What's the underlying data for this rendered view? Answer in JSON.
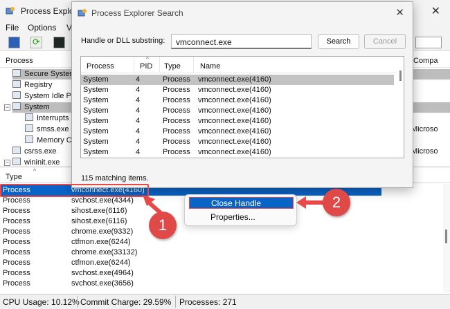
{
  "main_window": {
    "title": "Process Explo",
    "close_glyph": "✕",
    "menu": [
      "File",
      "Options",
      "V"
    ]
  },
  "toolbar": {
    "icons": [
      "save-icon",
      "refresh-icon",
      "cpu-graph-icon"
    ]
  },
  "process_tree": {
    "header_process": "Process",
    "header_company": "Compa",
    "rows": [
      {
        "name": "Secure Syster",
        "indent": 1,
        "selected": true
      },
      {
        "name": "Registry",
        "indent": 1,
        "selected": false
      },
      {
        "name": "System Idle Pr",
        "indent": 1,
        "selected": false
      },
      {
        "name": "System",
        "indent": 1,
        "selected": true
      },
      {
        "name": "Interrupts",
        "indent": 2,
        "selected": false
      },
      {
        "name": "smss.exe",
        "indent": 2,
        "selected": false
      },
      {
        "name": "Memory Co",
        "indent": 2,
        "selected": false
      },
      {
        "name": "csrss.exe",
        "indent": 0,
        "selected": false
      },
      {
        "name": "wininit.exe",
        "indent": 0,
        "selected": false
      }
    ],
    "company_values": [
      "Microso",
      "Microso"
    ]
  },
  "lower_pane": {
    "header_type": "Type",
    "rows": [
      {
        "type": "Process",
        "name": "vmconnect.exe(4160)"
      },
      {
        "type": "Process",
        "name": "svchost.exe(4344)"
      },
      {
        "type": "Process",
        "name": "sihost.exe(6116)"
      },
      {
        "type": "Process",
        "name": "sihost.exe(6116)"
      },
      {
        "type": "Process",
        "name": "chrome.exe(9332)"
      },
      {
        "type": "Process",
        "name": "ctfmon.exe(6244)"
      },
      {
        "type": "Process",
        "name": "chrome.exe(33132)"
      },
      {
        "type": "Process",
        "name": "ctfmon.exe(6244)"
      },
      {
        "type": "Process",
        "name": "svchost.exe(4964)"
      },
      {
        "type": "Process",
        "name": "svchost.exe(3656)"
      }
    ]
  },
  "status_bar": {
    "cpu": "CPU Usage: 10.12%",
    "commit": "Commit Charge: 29.59%",
    "processes": "Processes: 271"
  },
  "search_dialog": {
    "title": "Process Explorer Search",
    "close_glyph": "✕",
    "label": "Handle or DLL substring:",
    "input_value": "vmconnect.exe",
    "search_button": "Search",
    "cancel_button": "Cancel",
    "columns": [
      "Process",
      "PID",
      "Type",
      "Name"
    ],
    "results": [
      {
        "process": "System",
        "pid": "4",
        "type": "Process",
        "name": "vmconnect.exe(4160)"
      },
      {
        "process": "System",
        "pid": "4",
        "type": "Process",
        "name": "vmconnect.exe(4160)"
      },
      {
        "process": "System",
        "pid": "4",
        "type": "Process",
        "name": "vmconnect.exe(4160)"
      },
      {
        "process": "System",
        "pid": "4",
        "type": "Process",
        "name": "vmconnect.exe(4160)"
      },
      {
        "process": "System",
        "pid": "4",
        "type": "Process",
        "name": "vmconnect.exe(4160)"
      },
      {
        "process": "System",
        "pid": "4",
        "type": "Process",
        "name": "vmconnect.exe(4160)"
      },
      {
        "process": "System",
        "pid": "4",
        "type": "Process",
        "name": "vmconnect.exe(4160)"
      },
      {
        "process": "System",
        "pid": "4",
        "type": "Process",
        "name": "vmconnect.exe(4160)"
      }
    ],
    "match_count": "115 matching items."
  },
  "context_menu": {
    "close_handle": "Close Handle",
    "properties": "Properties..."
  },
  "annotations": {
    "step1": "1",
    "step2": "2",
    "color": "#e84848"
  }
}
